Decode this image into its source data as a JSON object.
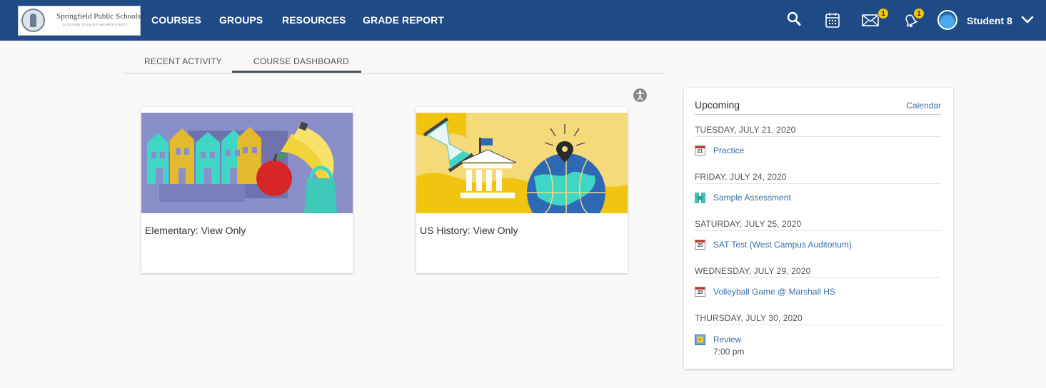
{
  "logo": {
    "name": "Springfield Public Schools",
    "tagline": "A CULTURE OF EQUITY AND PROFICIENCY"
  },
  "nav": {
    "links": [
      "COURSES",
      "GROUPS",
      "RESOURCES",
      "GRADE REPORT"
    ],
    "messages_badge": "1",
    "notifications_badge": "1",
    "username": "Student 8",
    "icons": [
      "search-icon",
      "calendar-icon",
      "mail-icon",
      "bell-icon",
      "chevron-down-icon"
    ]
  },
  "tabs": [
    {
      "label": "RECENT ACTIVITY",
      "active": false
    },
    {
      "label": "COURSE DASHBOARD",
      "active": true
    }
  ],
  "courses": [
    {
      "title": "Elementary: View Only",
      "theme_bg": "#8b8fc9"
    },
    {
      "title": "US History: View Only",
      "theme_bg": "#f5da7a"
    }
  ],
  "upcoming": {
    "title": "Upcoming",
    "calendar_link": "Calendar",
    "days": [
      {
        "date": "TUESDAY, JULY 21, 2020",
        "event": "Practice",
        "icon": "calendar-icon",
        "icon_num": "21",
        "time": ""
      },
      {
        "date": "FRIDAY, JULY 24, 2020",
        "event": "Sample Assessment",
        "icon": "assessment-icon",
        "icon_num": "",
        "time": ""
      },
      {
        "date": "SATURDAY, JULY 25, 2020",
        "event": "SAT Test (West Campus Auditorium)",
        "icon": "calendar-icon",
        "icon_num": "25",
        "time": ""
      },
      {
        "date": "WEDNESDAY, JULY 29, 2020",
        "event": "Volleyball Game @ Marshall HS",
        "icon": "calendar-icon",
        "icon_num": "29",
        "time": ""
      },
      {
        "date": "THURSDAY, JULY 30, 2020",
        "event": "Review",
        "icon": "assignment-icon",
        "icon_num": "",
        "time": "7:00 pm"
      }
    ]
  },
  "colors": {
    "nav_bg": "#1e4a85",
    "link": "#3a6ea5",
    "badge": "#f1c40f"
  }
}
